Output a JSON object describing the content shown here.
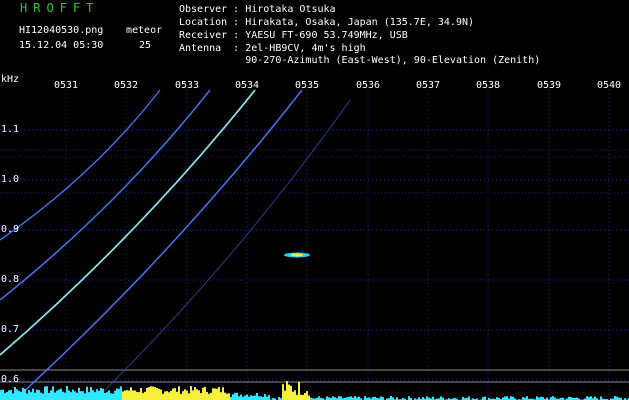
{
  "header": {
    "app_title": "HROFFT",
    "filename": "HI12040530.png",
    "type_label": "meteor",
    "datetime": "15.12.04 05:30",
    "count": "25",
    "observer": "Observer : Hirotaka Otsuka",
    "location": "Location : Hirakata, Osaka, Japan (135.7E, 34.9N)",
    "receiver": "Receiver : YAESU FT-690 53.749MHz, USB",
    "antenna": "Antenna  : 2el-HB9CV, 4m's high",
    "antenna2": "           90-270-Azimuth (East-West), 90-Elevation (Zenith)"
  },
  "axis": {
    "unit": "kHz",
    "time_ticks": [
      "0531",
      "0532",
      "0533",
      "0534",
      "0535",
      "0536",
      "0537",
      "0538",
      "0539",
      "0540"
    ],
    "freq_ticks": [
      "1.1",
      "1.0",
      "0.9",
      "0.8",
      "0.7",
      "0.6"
    ]
  },
  "colors": {
    "background": "#000000",
    "grid": "#1a2a9a",
    "trace": "#4a7cff",
    "trace_bright": "#9cf2ff",
    "title": "#22c83a",
    "noise_yellow": "#f6f03a",
    "noise_cyan": "#2fe8ff"
  }
}
